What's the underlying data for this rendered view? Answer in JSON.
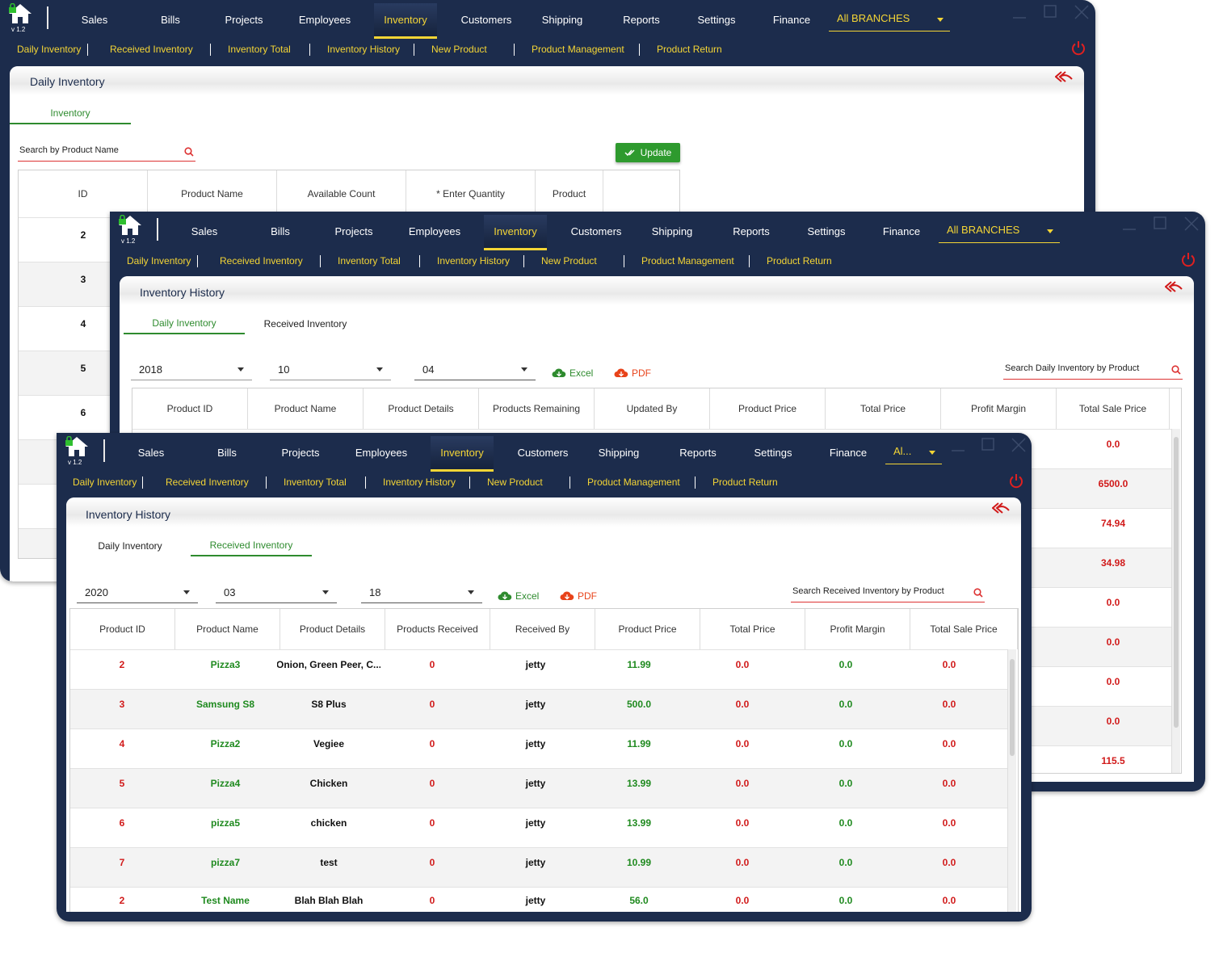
{
  "app": {
    "version": "v 1.2"
  },
  "nav": {
    "items": [
      "Sales",
      "Bills",
      "Projects",
      "Employees",
      "Inventory",
      "Customers",
      "Shipping",
      "Reports",
      "Settings",
      "Finance"
    ],
    "active": "Inventory",
    "branch_full": "All BRANCHES",
    "branch_short": "Al..."
  },
  "subnav": [
    "Daily Inventory",
    "Received Inventory",
    "Inventory Total",
    "Inventory History",
    "New Product",
    "Product Management",
    "Product Return"
  ],
  "colors": {
    "navy": "#1c2c4c",
    "accent": "#f4d535",
    "green": "#1f8a1f",
    "red": "#d11a1a"
  },
  "win1": {
    "title": "Daily Inventory",
    "tab": "Inventory",
    "search_placeholder": "Search by Product Name",
    "update_label": "Update",
    "columns": [
      "ID",
      "Product Name",
      "Available Count",
      "* Enter Quantity",
      "Product"
    ],
    "ids": [
      "2",
      "3",
      "4",
      "5",
      "6"
    ]
  },
  "win2": {
    "title": "Inventory History",
    "tabs": [
      "Daily Inventory",
      "Received Inventory"
    ],
    "year": "2018",
    "month": "10",
    "day": "04",
    "excel": "Excel",
    "pdf": "PDF",
    "search_placeholder": "Search Daily Inventory by Product",
    "columns": [
      "Product ID",
      "Product Name",
      "Product Details",
      "Products Remaining",
      "Updated By",
      "Product Price",
      "Total Price",
      "Profit Margin",
      "Total Sale Price"
    ],
    "total_sale": [
      "0.0",
      "6500.0",
      "74.94",
      "34.98",
      "0.0",
      "0.0",
      "0.0",
      "0.0",
      "115.5"
    ]
  },
  "win3": {
    "title": "Inventory History",
    "tabs": [
      "Daily Inventory",
      "Received Inventory"
    ],
    "year": "2020",
    "month": "03",
    "day": "18",
    "excel": "Excel",
    "pdf": "PDF",
    "search_placeholder": "Search Received Inventory by Product",
    "columns": [
      "Product ID",
      "Product Name",
      "Product Details",
      "Products Received",
      "Received By",
      "Product Price",
      "Total Price",
      "Profit Margin",
      "Total Sale Price"
    ],
    "rows": [
      [
        "2",
        "Pizza3",
        "Onion, Green Peer, C...",
        "0",
        "jetty",
        "11.99",
        "0.0",
        "0.0",
        "0.0"
      ],
      [
        "3",
        "Samsung S8",
        "S8 Plus",
        "0",
        "jetty",
        "500.0",
        "0.0",
        "0.0",
        "0.0"
      ],
      [
        "4",
        "Pizza2",
        "Vegiee",
        "0",
        "jetty",
        "11.99",
        "0.0",
        "0.0",
        "0.0"
      ],
      [
        "5",
        "Pizza4",
        "Chicken",
        "0",
        "jetty",
        "13.99",
        "0.0",
        "0.0",
        "0.0"
      ],
      [
        "6",
        "pizza5",
        "chicken",
        "0",
        "jetty",
        "13.99",
        "0.0",
        "0.0",
        "0.0"
      ],
      [
        "7",
        "pizza7",
        "test",
        "0",
        "jetty",
        "10.99",
        "0.0",
        "0.0",
        "0.0"
      ],
      [
        "2",
        "Test Name",
        "Blah Blah Blah",
        "0",
        "jetty",
        "56.0",
        "0.0",
        "0.0",
        "0.0"
      ]
    ]
  }
}
